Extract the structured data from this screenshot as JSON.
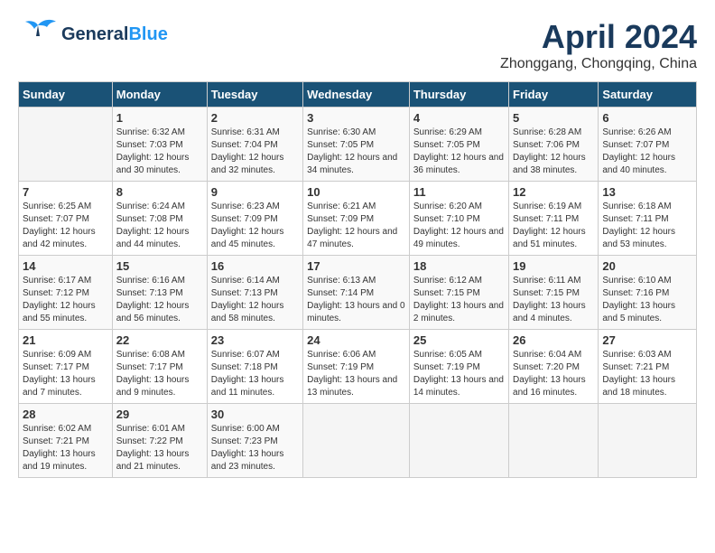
{
  "header": {
    "logo_line1": "General",
    "logo_line2": "Blue",
    "title": "April 2024",
    "subtitle": "Zhonggang, Chongqing, China"
  },
  "days_of_week": [
    "Sunday",
    "Monday",
    "Tuesday",
    "Wednesday",
    "Thursday",
    "Friday",
    "Saturday"
  ],
  "weeks": [
    [
      {
        "day": "",
        "sunrise": "",
        "sunset": "",
        "daylight": ""
      },
      {
        "day": "1",
        "sunrise": "Sunrise: 6:32 AM",
        "sunset": "Sunset: 7:03 PM",
        "daylight": "Daylight: 12 hours and 30 minutes."
      },
      {
        "day": "2",
        "sunrise": "Sunrise: 6:31 AM",
        "sunset": "Sunset: 7:04 PM",
        "daylight": "Daylight: 12 hours and 32 minutes."
      },
      {
        "day": "3",
        "sunrise": "Sunrise: 6:30 AM",
        "sunset": "Sunset: 7:05 PM",
        "daylight": "Daylight: 12 hours and 34 minutes."
      },
      {
        "day": "4",
        "sunrise": "Sunrise: 6:29 AM",
        "sunset": "Sunset: 7:05 PM",
        "daylight": "Daylight: 12 hours and 36 minutes."
      },
      {
        "day": "5",
        "sunrise": "Sunrise: 6:28 AM",
        "sunset": "Sunset: 7:06 PM",
        "daylight": "Daylight: 12 hours and 38 minutes."
      },
      {
        "day": "6",
        "sunrise": "Sunrise: 6:26 AM",
        "sunset": "Sunset: 7:07 PM",
        "daylight": "Daylight: 12 hours and 40 minutes."
      }
    ],
    [
      {
        "day": "7",
        "sunrise": "Sunrise: 6:25 AM",
        "sunset": "Sunset: 7:07 PM",
        "daylight": "Daylight: 12 hours and 42 minutes."
      },
      {
        "day": "8",
        "sunrise": "Sunrise: 6:24 AM",
        "sunset": "Sunset: 7:08 PM",
        "daylight": "Daylight: 12 hours and 44 minutes."
      },
      {
        "day": "9",
        "sunrise": "Sunrise: 6:23 AM",
        "sunset": "Sunset: 7:09 PM",
        "daylight": "Daylight: 12 hours and 45 minutes."
      },
      {
        "day": "10",
        "sunrise": "Sunrise: 6:21 AM",
        "sunset": "Sunset: 7:09 PM",
        "daylight": "Daylight: 12 hours and 47 minutes."
      },
      {
        "day": "11",
        "sunrise": "Sunrise: 6:20 AM",
        "sunset": "Sunset: 7:10 PM",
        "daylight": "Daylight: 12 hours and 49 minutes."
      },
      {
        "day": "12",
        "sunrise": "Sunrise: 6:19 AM",
        "sunset": "Sunset: 7:11 PM",
        "daylight": "Daylight: 12 hours and 51 minutes."
      },
      {
        "day": "13",
        "sunrise": "Sunrise: 6:18 AM",
        "sunset": "Sunset: 7:11 PM",
        "daylight": "Daylight: 12 hours and 53 minutes."
      }
    ],
    [
      {
        "day": "14",
        "sunrise": "Sunrise: 6:17 AM",
        "sunset": "Sunset: 7:12 PM",
        "daylight": "Daylight: 12 hours and 55 minutes."
      },
      {
        "day": "15",
        "sunrise": "Sunrise: 6:16 AM",
        "sunset": "Sunset: 7:13 PM",
        "daylight": "Daylight: 12 hours and 56 minutes."
      },
      {
        "day": "16",
        "sunrise": "Sunrise: 6:14 AM",
        "sunset": "Sunset: 7:13 PM",
        "daylight": "Daylight: 12 hours and 58 minutes."
      },
      {
        "day": "17",
        "sunrise": "Sunrise: 6:13 AM",
        "sunset": "Sunset: 7:14 PM",
        "daylight": "Daylight: 13 hours and 0 minutes."
      },
      {
        "day": "18",
        "sunrise": "Sunrise: 6:12 AM",
        "sunset": "Sunset: 7:15 PM",
        "daylight": "Daylight: 13 hours and 2 minutes."
      },
      {
        "day": "19",
        "sunrise": "Sunrise: 6:11 AM",
        "sunset": "Sunset: 7:15 PM",
        "daylight": "Daylight: 13 hours and 4 minutes."
      },
      {
        "day": "20",
        "sunrise": "Sunrise: 6:10 AM",
        "sunset": "Sunset: 7:16 PM",
        "daylight": "Daylight: 13 hours and 5 minutes."
      }
    ],
    [
      {
        "day": "21",
        "sunrise": "Sunrise: 6:09 AM",
        "sunset": "Sunset: 7:17 PM",
        "daylight": "Daylight: 13 hours and 7 minutes."
      },
      {
        "day": "22",
        "sunrise": "Sunrise: 6:08 AM",
        "sunset": "Sunset: 7:17 PM",
        "daylight": "Daylight: 13 hours and 9 minutes."
      },
      {
        "day": "23",
        "sunrise": "Sunrise: 6:07 AM",
        "sunset": "Sunset: 7:18 PM",
        "daylight": "Daylight: 13 hours and 11 minutes."
      },
      {
        "day": "24",
        "sunrise": "Sunrise: 6:06 AM",
        "sunset": "Sunset: 7:19 PM",
        "daylight": "Daylight: 13 hours and 13 minutes."
      },
      {
        "day": "25",
        "sunrise": "Sunrise: 6:05 AM",
        "sunset": "Sunset: 7:19 PM",
        "daylight": "Daylight: 13 hours and 14 minutes."
      },
      {
        "day": "26",
        "sunrise": "Sunrise: 6:04 AM",
        "sunset": "Sunset: 7:20 PM",
        "daylight": "Daylight: 13 hours and 16 minutes."
      },
      {
        "day": "27",
        "sunrise": "Sunrise: 6:03 AM",
        "sunset": "Sunset: 7:21 PM",
        "daylight": "Daylight: 13 hours and 18 minutes."
      }
    ],
    [
      {
        "day": "28",
        "sunrise": "Sunrise: 6:02 AM",
        "sunset": "Sunset: 7:21 PM",
        "daylight": "Daylight: 13 hours and 19 minutes."
      },
      {
        "day": "29",
        "sunrise": "Sunrise: 6:01 AM",
        "sunset": "Sunset: 7:22 PM",
        "daylight": "Daylight: 13 hours and 21 minutes."
      },
      {
        "day": "30",
        "sunrise": "Sunrise: 6:00 AM",
        "sunset": "Sunset: 7:23 PM",
        "daylight": "Daylight: 13 hours and 23 minutes."
      },
      {
        "day": "",
        "sunrise": "",
        "sunset": "",
        "daylight": ""
      },
      {
        "day": "",
        "sunrise": "",
        "sunset": "",
        "daylight": ""
      },
      {
        "day": "",
        "sunrise": "",
        "sunset": "",
        "daylight": ""
      },
      {
        "day": "",
        "sunrise": "",
        "sunset": "",
        "daylight": ""
      }
    ]
  ]
}
